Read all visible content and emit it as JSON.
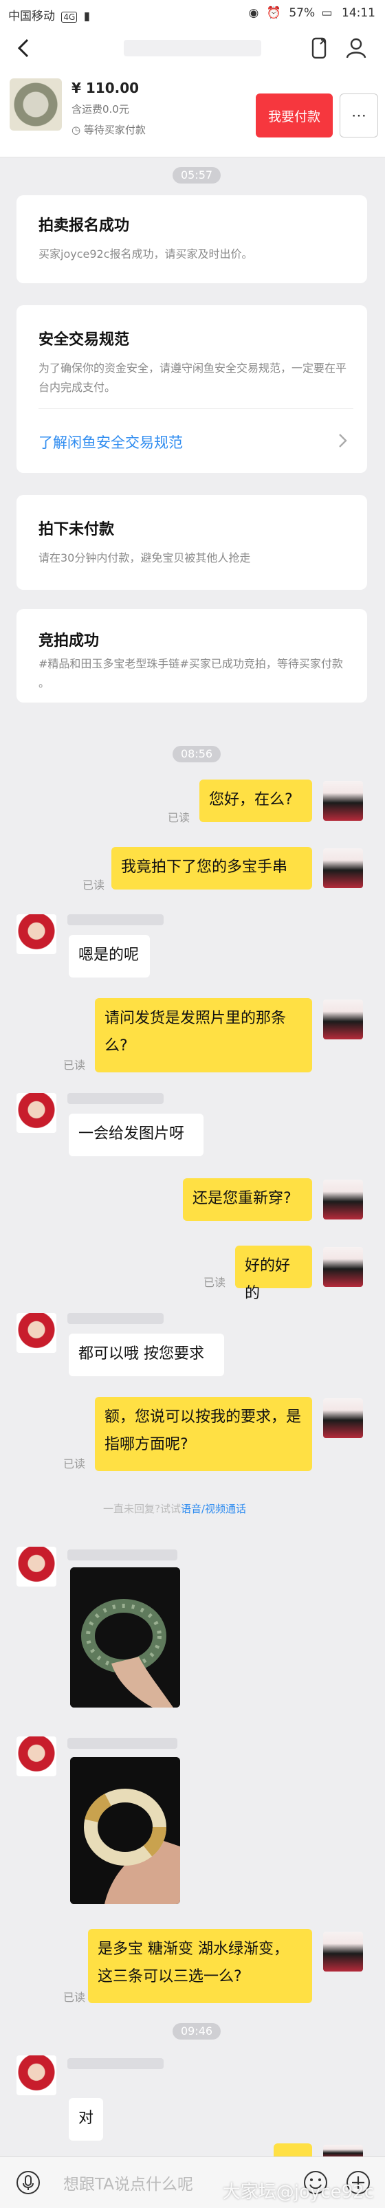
{
  "status_bar": {
    "carrier": "中国移动",
    "network": "4G",
    "battery": "57%",
    "time": "14:11"
  },
  "header": {
    "title": "",
    "back_icon": "back-arrow-icon",
    "call_icon": "phone-icon"
  },
  "product": {
    "price": "¥ 110.00",
    "postage": "含运费0.0元",
    "status": "等待买家付款",
    "pay_button": "我要付款",
    "more_button": "⋯"
  },
  "times": [
    "05:57",
    "08:56",
    "09:46"
  ],
  "cards": {
    "auction_signup": {
      "title": "拍卖报名成功",
      "desc": "买家joyce92c报名成功，请买家及时出价。"
    },
    "safe_trade": {
      "title": "安全交易规范",
      "desc": "为了确保你的资金安全，请遵守闲鱼安全交易规范，一定要在平台内完成支付。",
      "link": "了解闲鱼安全交易规范"
    },
    "unpaid": {
      "title": "拍下未付款",
      "desc": "请在30分钟内付款，避免宝贝被其他人抢走"
    },
    "auction_won": {
      "title": "竞拍成功",
      "desc": "#精品和田玉多宝老型珠手链#买家已成功竞拍，等待买家付款 。"
    }
  },
  "read_label": "已读",
  "messages": {
    "m1": "您好，在么?",
    "m2": "我竟拍下了您的多宝手串",
    "m3": "嗯是的呢",
    "m4": "请问发货是发照片里的那条么?",
    "m5": "一会给发图片呀",
    "m6": "还是您重新穿?",
    "m7": "好的好的",
    "m8": "都可以哦 按您要求",
    "m9": "额，您说可以按我的要求，是指哪方面呢?",
    "m10": "是多宝 糖渐变 湖水绿渐变，这三条可以三选一么?",
    "m11": "对"
  },
  "call_hint": {
    "text": "一直未回复?试试",
    "link": "语音/视频通话"
  },
  "input": {
    "placeholder": "想跟TA说点什么呢"
  },
  "watermark": "大家坛@joyce92c",
  "colors": {
    "my_bubble": "#ffe044",
    "their_bubble": "#ffffff",
    "accent_red": "#f6373e",
    "link_blue": "#2f8cf0"
  }
}
